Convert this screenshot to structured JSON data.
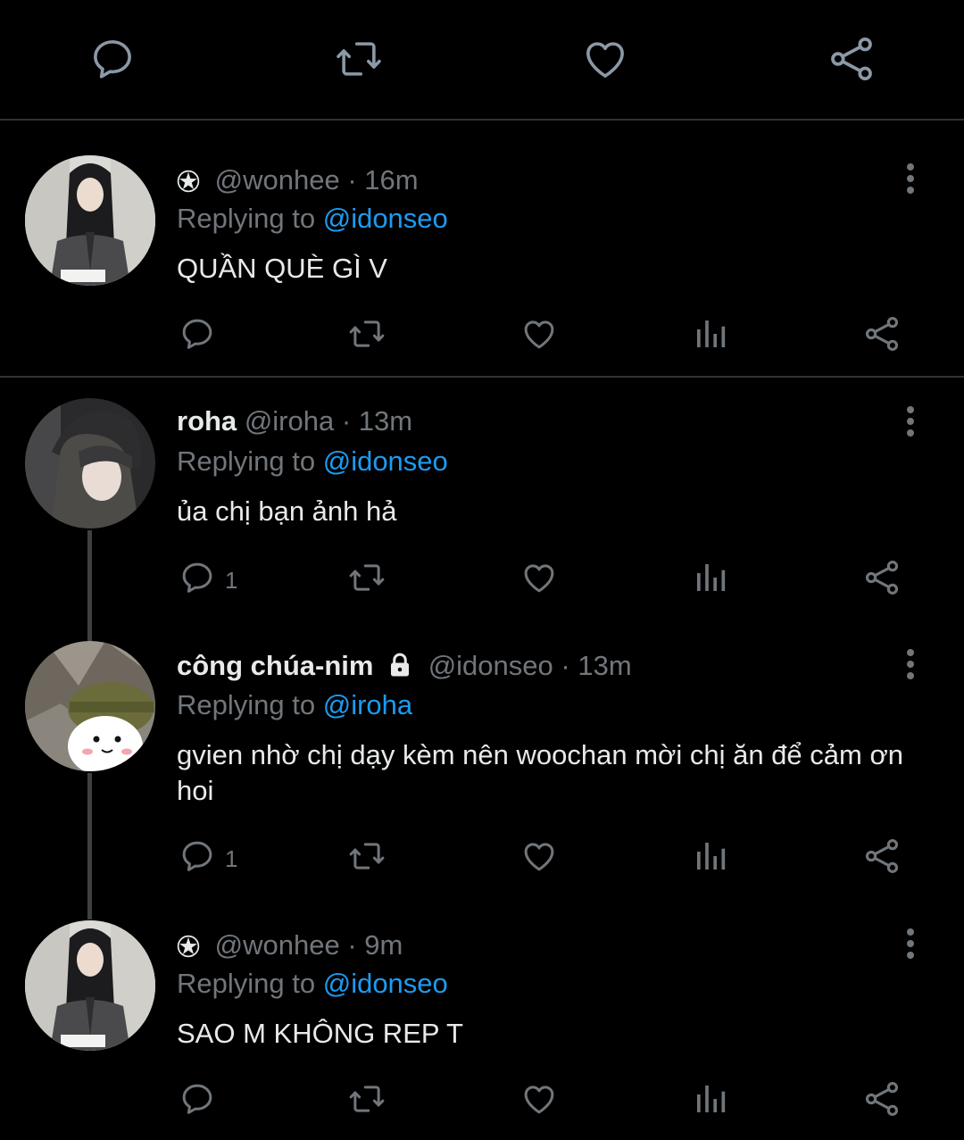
{
  "colors": {
    "background": "#000000",
    "text": "#e7e9ea",
    "muted": "#71767b",
    "accent": "#1d9bf0",
    "divider": "#2f3336"
  },
  "top_actions": [
    {
      "icon": "reply-icon"
    },
    {
      "icon": "retweet-icon"
    },
    {
      "icon": "like-icon"
    },
    {
      "icon": "share-icon"
    }
  ],
  "reply_prefix": "Replying to",
  "tweets": [
    {
      "name": "",
      "name_icon": "pentagram-icon",
      "handle": "@wonhee",
      "time": "16m",
      "reply_to": "@idonseo",
      "text": "QUẦN QUÈ GÌ V",
      "reply_count": ""
    },
    {
      "name": "roha",
      "handle": "@iroha",
      "time": "13m",
      "reply_to": "@idonseo",
      "text": "ủa chị bạn ảnh hả",
      "reply_count": "1"
    },
    {
      "name": "công chúa-nim",
      "name_icon": "lock-icon",
      "handle": "@idonseo",
      "time": "13m",
      "reply_to": "@iroha",
      "text": "gvien nhờ chị dạy kèm nên woochan mời chị ăn để cảm ơn hoi",
      "reply_count": "1"
    },
    {
      "name": "",
      "name_icon": "pentagram-icon",
      "handle": "@wonhee",
      "time": "9m",
      "reply_to": "@idonseo",
      "text": "SAO M KHÔNG REP T",
      "reply_count": ""
    }
  ],
  "separator": "·"
}
